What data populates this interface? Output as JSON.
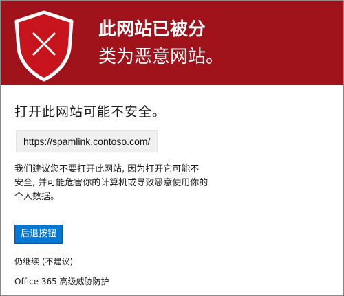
{
  "banner": {
    "title_line1": "此网站已被分",
    "title_line2": "类为恶意网站。",
    "colors": {
      "background": "#a0131b",
      "shield_fill": "#c8151d",
      "shield_outline": "#ffffff"
    },
    "icon": "shield-x-icon"
  },
  "main": {
    "heading": "打开此网站可能不安全。",
    "url": "https://spamlink.contoso.com/",
    "warning_line1": "我们建议您不要打开此网站, 因为打开它可能不",
    "warning_line2": "安全, 并可能危害你的计算机或导致恶意使用你的",
    "warning_line3": "个人数据。",
    "back_button_label": "后退按钮",
    "continue_link": "仍继续 (不建议)",
    "footer": "Office 365 高级威胁防护"
  },
  "colors": {
    "button": "#0078d4"
  }
}
